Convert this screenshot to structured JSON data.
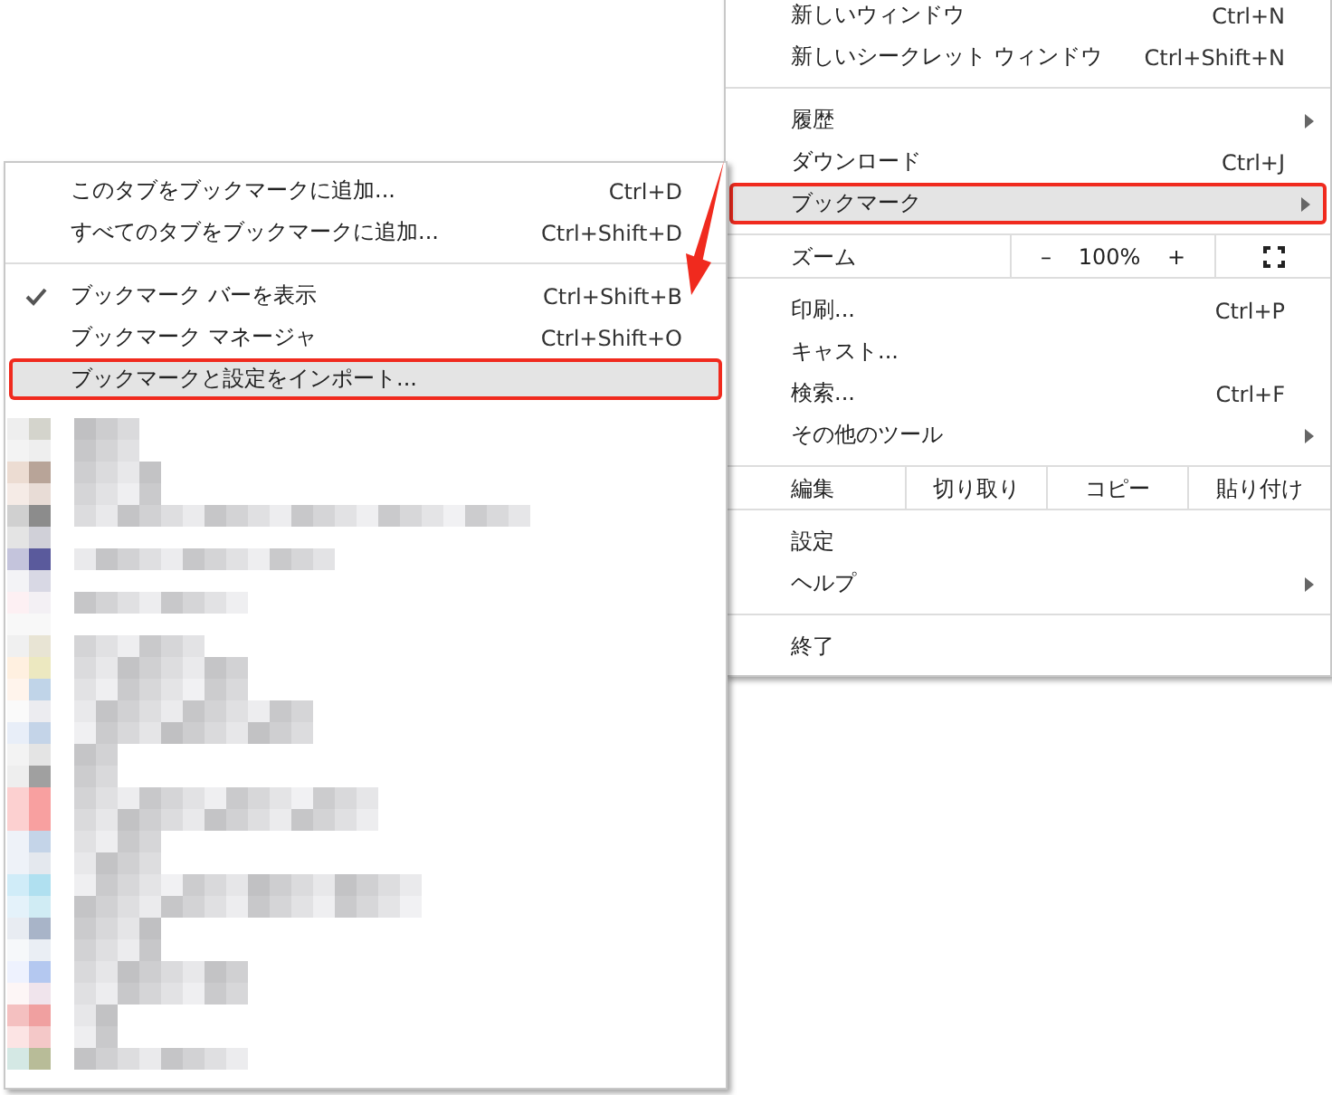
{
  "main_menu": {
    "items": [
      {
        "kind": "item",
        "label": "新しいウィンドウ",
        "shortcut": "Ctrl+N",
        "submenu": false,
        "selected": false,
        "annotated": false
      },
      {
        "kind": "item",
        "label": "新しいシークレット ウィンドウ",
        "shortcut": "Ctrl+Shift+N",
        "submenu": false,
        "selected": false,
        "annotated": false
      },
      {
        "kind": "separator"
      },
      {
        "kind": "item",
        "label": "履歴",
        "submenu": true,
        "selected": false,
        "annotated": false
      },
      {
        "kind": "item",
        "label": "ダウンロード",
        "shortcut": "Ctrl+J",
        "submenu": false,
        "selected": false,
        "annotated": false
      },
      {
        "kind": "item",
        "label": "ブックマーク",
        "submenu": true,
        "selected": true,
        "annotated": true
      },
      {
        "kind": "separator"
      },
      {
        "kind": "zoom",
        "label": "ズーム",
        "minus": "–",
        "value": "100%",
        "plus": "+"
      },
      {
        "kind": "separator"
      },
      {
        "kind": "item",
        "label": "印刷...",
        "shortcut": "Ctrl+P",
        "submenu": false,
        "selected": false,
        "annotated": false
      },
      {
        "kind": "item",
        "label": "キャスト...",
        "submenu": false,
        "selected": false,
        "annotated": false
      },
      {
        "kind": "item",
        "label": "検索...",
        "shortcut": "Ctrl+F",
        "submenu": false,
        "selected": false,
        "annotated": false
      },
      {
        "kind": "item",
        "label": "その他のツール",
        "submenu": true,
        "selected": false,
        "annotated": false
      },
      {
        "kind": "separator"
      },
      {
        "kind": "edit",
        "label": "編集",
        "buttons": [
          "切り取り",
          "コピー",
          "貼り付け"
        ]
      },
      {
        "kind": "separator"
      },
      {
        "kind": "item",
        "label": "設定",
        "submenu": false,
        "selected": false,
        "annotated": false
      },
      {
        "kind": "item",
        "label": "ヘルプ",
        "submenu": true,
        "selected": false,
        "annotated": false
      },
      {
        "kind": "separator"
      },
      {
        "kind": "item",
        "label": "終了",
        "submenu": false,
        "selected": false,
        "annotated": false
      }
    ]
  },
  "bookmark_menu": {
    "items": [
      {
        "kind": "item",
        "label": "このタブをブックマークに追加...",
        "shortcut": "Ctrl+D",
        "checked": false,
        "selected": false,
        "annotated": false
      },
      {
        "kind": "item",
        "label": "すべてのタブをブックマークに追加...",
        "shortcut": "Ctrl+Shift+D",
        "checked": false,
        "selected": false,
        "annotated": false
      },
      {
        "kind": "separator"
      },
      {
        "kind": "item",
        "label": "ブックマーク バーを表示",
        "shortcut": "Ctrl+Shift+B",
        "checked": true,
        "selected": false,
        "annotated": false
      },
      {
        "kind": "item",
        "label": "ブックマーク マネージャ",
        "shortcut": "Ctrl+Shift+O",
        "checked": false,
        "selected": false,
        "annotated": false
      },
      {
        "kind": "item",
        "label": "ブックマークと設定をインポート...",
        "checked": false,
        "selected": true,
        "annotated": true
      }
    ]
  }
}
